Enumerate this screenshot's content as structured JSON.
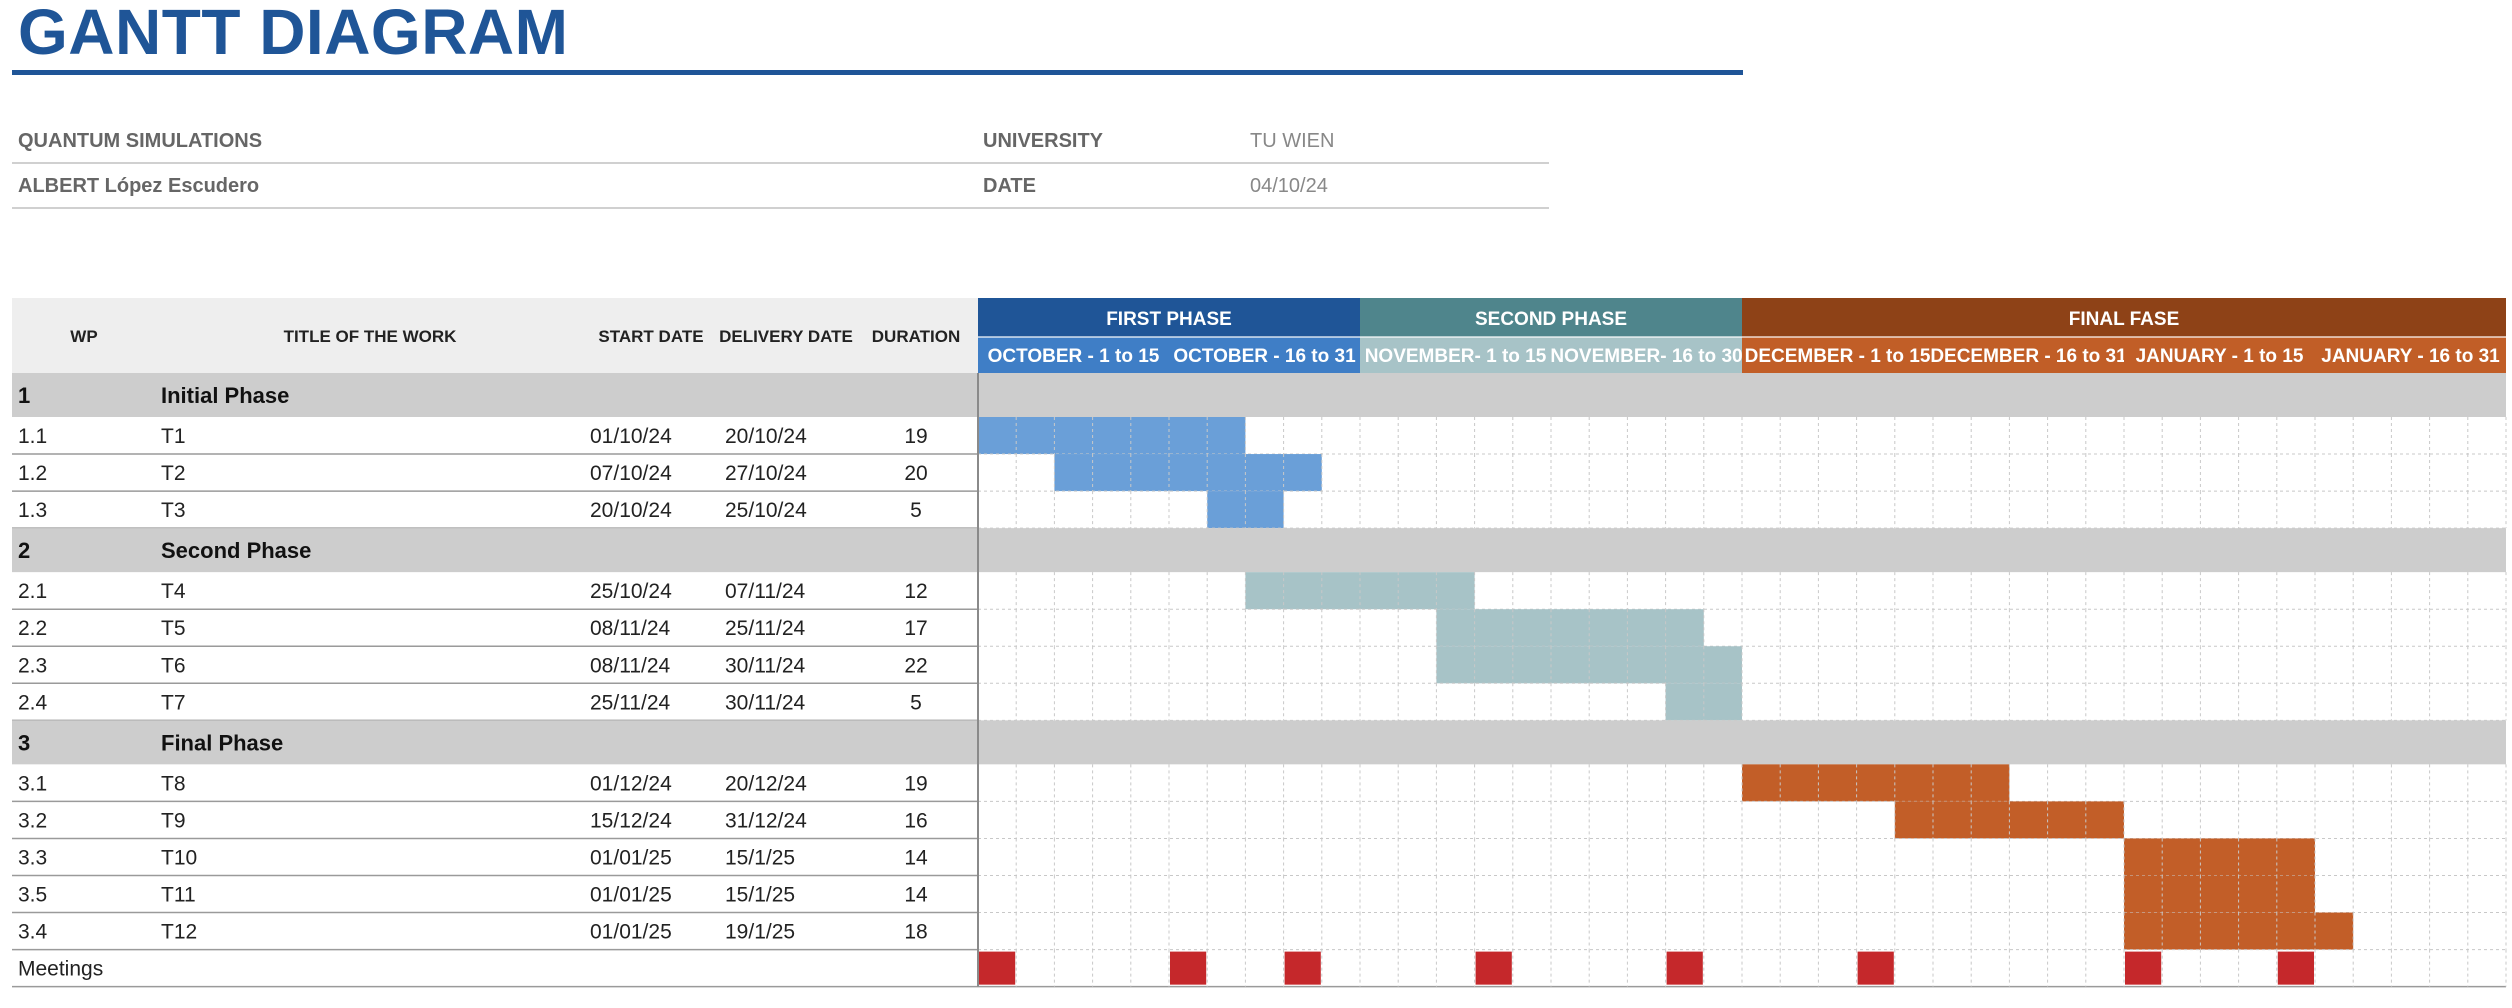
{
  "title": "GANTT DIAGRAM",
  "info": {
    "project": "QUANTUM SIMULATIONS",
    "author": "ALBERT López Escudero",
    "university_label": "UNIVERSITY",
    "university_value": "TU WIEN",
    "date_label": "DATE",
    "date_value": "04/10/24"
  },
  "colors": {
    "title": "#1f5597",
    "phase1_header": "#1f5597",
    "phase1_sub": "#3f7ec6",
    "phase1_bar": "#6a9fd8",
    "phase2_header": "#4f858c",
    "phase2_sub": "#a7c3c7",
    "phase2_bar": "#a7c3c7",
    "phase3_header": "#8e4217",
    "phase3_sub": "#c15e27",
    "phase3_bar": "#c25e28",
    "meeting": "#c5282b",
    "section_bg": "#cdcdcd",
    "header_bg": "#eeeeee"
  },
  "chart_data": {
    "type": "gantt",
    "columns": [
      "WP",
      "TITLE OF THE WORK",
      "START DATE",
      "DELIVERY DATE",
      "DURATION"
    ],
    "phases": [
      {
        "name": "FIRST PHASE",
        "periods": [
          "OCTOBER - 1 to 15",
          "OCTOBER - 16 to 31"
        ]
      },
      {
        "name": "SECOND PHASE",
        "periods": [
          "NOVEMBER- 1 to 15",
          "NOVEMBER- 16 to 30"
        ]
      },
      {
        "name": "FINAL FASE",
        "periods": [
          "DECEMBER - 1 to 15",
          "DECEMBER - 16 to 31",
          "JANUARY - 1 to 15",
          "JANUARY - 16 to 31"
        ]
      }
    ],
    "sections": [
      {
        "wp": "1",
        "title": "Initial Phase",
        "phase": 1,
        "tasks": [
          {
            "wp": "1.1",
            "title": "T1",
            "start": "01/10/24",
            "delivery": "20/10/24",
            "duration": 19
          },
          {
            "wp": "1.2",
            "title": "T2",
            "start": "07/10/24",
            "delivery": "27/10/24",
            "duration": 20
          },
          {
            "wp": "1.3",
            "title": "T3",
            "start": "20/10/24",
            "delivery": "25/10/24",
            "duration": 5
          }
        ]
      },
      {
        "wp": "2",
        "title": "Second Phase",
        "phase": 2,
        "tasks": [
          {
            "wp": "2.1",
            "title": "T4",
            "start": "25/10/24",
            "delivery": "07/11/24",
            "duration": 12
          },
          {
            "wp": "2.2",
            "title": "T5",
            "start": "08/11/24",
            "delivery": "25/11/24",
            "duration": 17
          },
          {
            "wp": "2.3",
            "title": "T6",
            "start": "08/11/24",
            "delivery": "30/11/24",
            "duration": 22
          },
          {
            "wp": "2.4",
            "title": "T7",
            "start": "25/11/24",
            "delivery": "30/11/24",
            "duration": 5
          }
        ]
      },
      {
        "wp": "3",
        "title": "Final Phase",
        "phase": 3,
        "tasks": [
          {
            "wp": "3.1",
            "title": "T8",
            "start": "01/12/24",
            "delivery": "20/12/24",
            "duration": 19
          },
          {
            "wp": "3.2",
            "title": "T9",
            "start": "15/12/24",
            "delivery": "31/12/24",
            "duration": 16
          },
          {
            "wp": "3.3",
            "title": "T10",
            "start": "01/01/25",
            "delivery": "15/1/25",
            "duration": 14
          },
          {
            "wp": "3.5",
            "title": "T11",
            "start": "01/01/25",
            "delivery": "15/1/25",
            "duration": 14
          },
          {
            "wp": "3.4",
            "title": "T12",
            "start": "01/01/25",
            "delivery": "19/1/25",
            "duration": 18
          }
        ]
      }
    ],
    "meetings_label": "Meetings",
    "meeting_dates": [
      "01/10/24",
      "16/10/24",
      "28/10/24",
      "12/11/24",
      "27/11/24",
      "12/12/24",
      "03/01/25",
      "15/01/25"
    ]
  }
}
